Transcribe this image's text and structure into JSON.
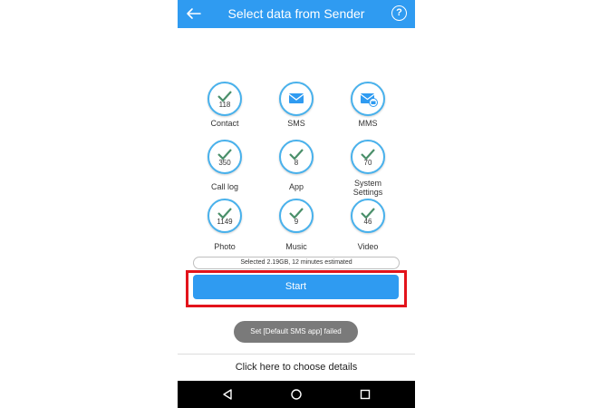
{
  "header": {
    "title": "Select data from Sender",
    "back_icon": "arrow-left-icon",
    "help_icon": "help-circle-icon",
    "help_glyph": "?",
    "color": "#2f9bf1"
  },
  "items": [
    {
      "label": "Contact",
      "count": "118",
      "icon": "check-icon"
    },
    {
      "label": "SMS",
      "count": "",
      "icon": "envelope-icon"
    },
    {
      "label": "MMS",
      "count": "",
      "icon": "mms-icon"
    },
    {
      "label": "Call log",
      "count": "350",
      "icon": "check-icon"
    },
    {
      "label": "App",
      "count": "8",
      "icon": "check-icon"
    },
    {
      "label": "System Settings",
      "label_line1": "System",
      "label_line2": "Settings",
      "count": "70",
      "icon": "check-icon"
    },
    {
      "label": "Photo",
      "count": "1149",
      "icon": "check-icon"
    },
    {
      "label": "Music",
      "count": "9",
      "icon": "check-icon"
    },
    {
      "label": "Video",
      "count": "46",
      "icon": "check-icon"
    }
  ],
  "summary": {
    "text": "Selected 2.19GB, 12 minutes estimated"
  },
  "start_button": {
    "label": "Start",
    "highlight_color": "#e3131b"
  },
  "toast": {
    "text": "Set [Default SMS app] failed"
  },
  "details_link": {
    "label": "Click here to choose details"
  },
  "navbar": {
    "icons": [
      "back-triangle-icon",
      "home-circle-icon",
      "recents-square-icon"
    ]
  },
  "colors": {
    "accent": "#2f9bf1",
    "circle_border": "#48b1ec",
    "check": "#4a8f6a"
  }
}
